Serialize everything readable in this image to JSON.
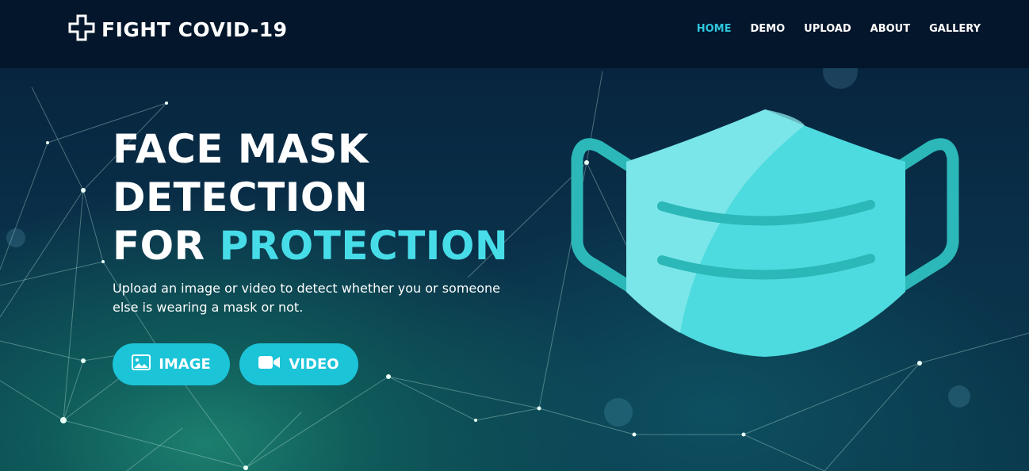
{
  "brand": {
    "logo_icon": "medical-cross-icon",
    "name": "FIGHT COVID-19"
  },
  "nav": {
    "items": [
      {
        "label": "HOME",
        "active": true
      },
      {
        "label": "DEMO",
        "active": false
      },
      {
        "label": "UPLOAD",
        "active": false
      },
      {
        "label": "ABOUT",
        "active": false
      },
      {
        "label": "GALLERY",
        "active": false
      }
    ]
  },
  "hero": {
    "headline_line1": "FACE MASK",
    "headline_line2": "DETECTION",
    "headline_line3_prefix": "FOR",
    "headline_line3_accent": "PROTECTION",
    "subtitle": "Upload an image or video to detect whether you or someone else is wearing a mask or not.",
    "image_button": {
      "label": "IMAGE",
      "icon": "image-icon"
    },
    "video_button": {
      "label": "VIDEO",
      "icon": "video-camera-icon"
    },
    "illustration": "face-mask-icon"
  },
  "colors": {
    "navbar_bg": "#03162b",
    "accent": "#47dde8",
    "active_nav": "#2fc6dd",
    "button_bg": "#1cc4d8",
    "mask_fill": "#4ddbdf",
    "mask_strap": "#2cb8b8"
  }
}
